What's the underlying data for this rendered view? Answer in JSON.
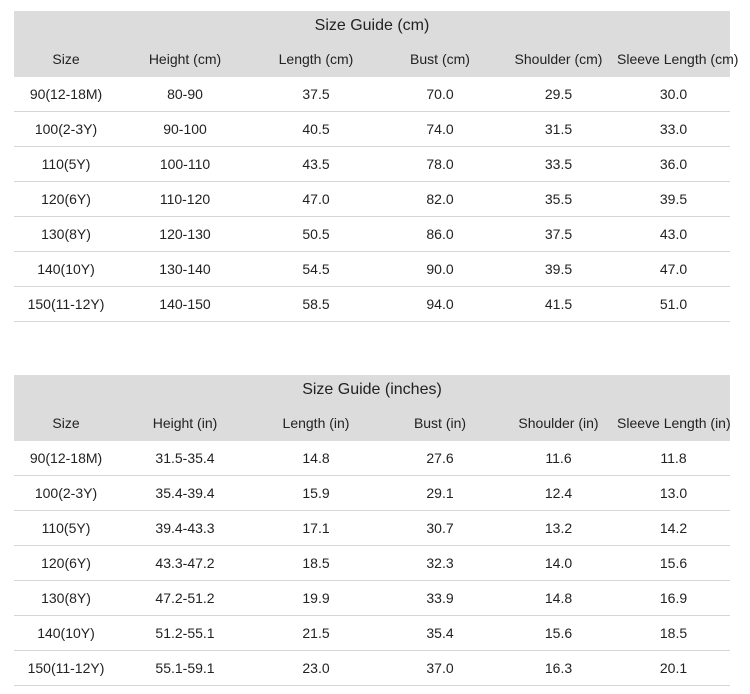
{
  "tables": [
    {
      "title": "Size Guide (cm)",
      "headers": [
        "Size",
        "Height (cm)",
        "Length (cm)",
        "Bust (cm)",
        "Shoulder (cm)",
        "Sleeve Length (cm)"
      ],
      "rows": [
        [
          "90(12-18M)",
          "80-90",
          "37.5",
          "70.0",
          "29.5",
          "30.0"
        ],
        [
          "100(2-3Y)",
          "90-100",
          "40.5",
          "74.0",
          "31.5",
          "33.0"
        ],
        [
          "110(5Y)",
          "100-110",
          "43.5",
          "78.0",
          "33.5",
          "36.0"
        ],
        [
          "120(6Y)",
          "110-120",
          "47.0",
          "82.0",
          "35.5",
          "39.5"
        ],
        [
          "130(8Y)",
          "120-130",
          "50.5",
          "86.0",
          "37.5",
          "43.0"
        ],
        [
          "140(10Y)",
          "130-140",
          "54.5",
          "90.0",
          "39.5",
          "47.0"
        ],
        [
          "150(11-12Y)",
          "140-150",
          "58.5",
          "94.0",
          "41.5",
          "51.0"
        ]
      ]
    },
    {
      "title": "Size Guide (inches)",
      "headers": [
        "Size",
        "Height (in)",
        "Length (in)",
        "Bust (in)",
        "Shoulder (in)",
        "Sleeve Length (in)"
      ],
      "rows": [
        [
          "90(12-18M)",
          "31.5-35.4",
          "14.8",
          "27.6",
          "11.6",
          "11.8"
        ],
        [
          "100(2-3Y)",
          "35.4-39.4",
          "15.9",
          "29.1",
          "12.4",
          "13.0"
        ],
        [
          "110(5Y)",
          "39.4-43.3",
          "17.1",
          "30.7",
          "13.2",
          "14.2"
        ],
        [
          "120(6Y)",
          "43.3-47.2",
          "18.5",
          "32.3",
          "14.0",
          "15.6"
        ],
        [
          "130(8Y)",
          "47.2-51.2",
          "19.9",
          "33.9",
          "14.8",
          "16.9"
        ],
        [
          "140(10Y)",
          "51.2-55.1",
          "21.5",
          "35.4",
          "15.6",
          "18.5"
        ],
        [
          "150(11-12Y)",
          "55.1-59.1",
          "23.0",
          "37.0",
          "16.3",
          "20.1"
        ]
      ]
    }
  ],
  "colors": {
    "header_bg": "#dcdcdc",
    "row_border": "#d6d6d6",
    "text": "#222222"
  }
}
